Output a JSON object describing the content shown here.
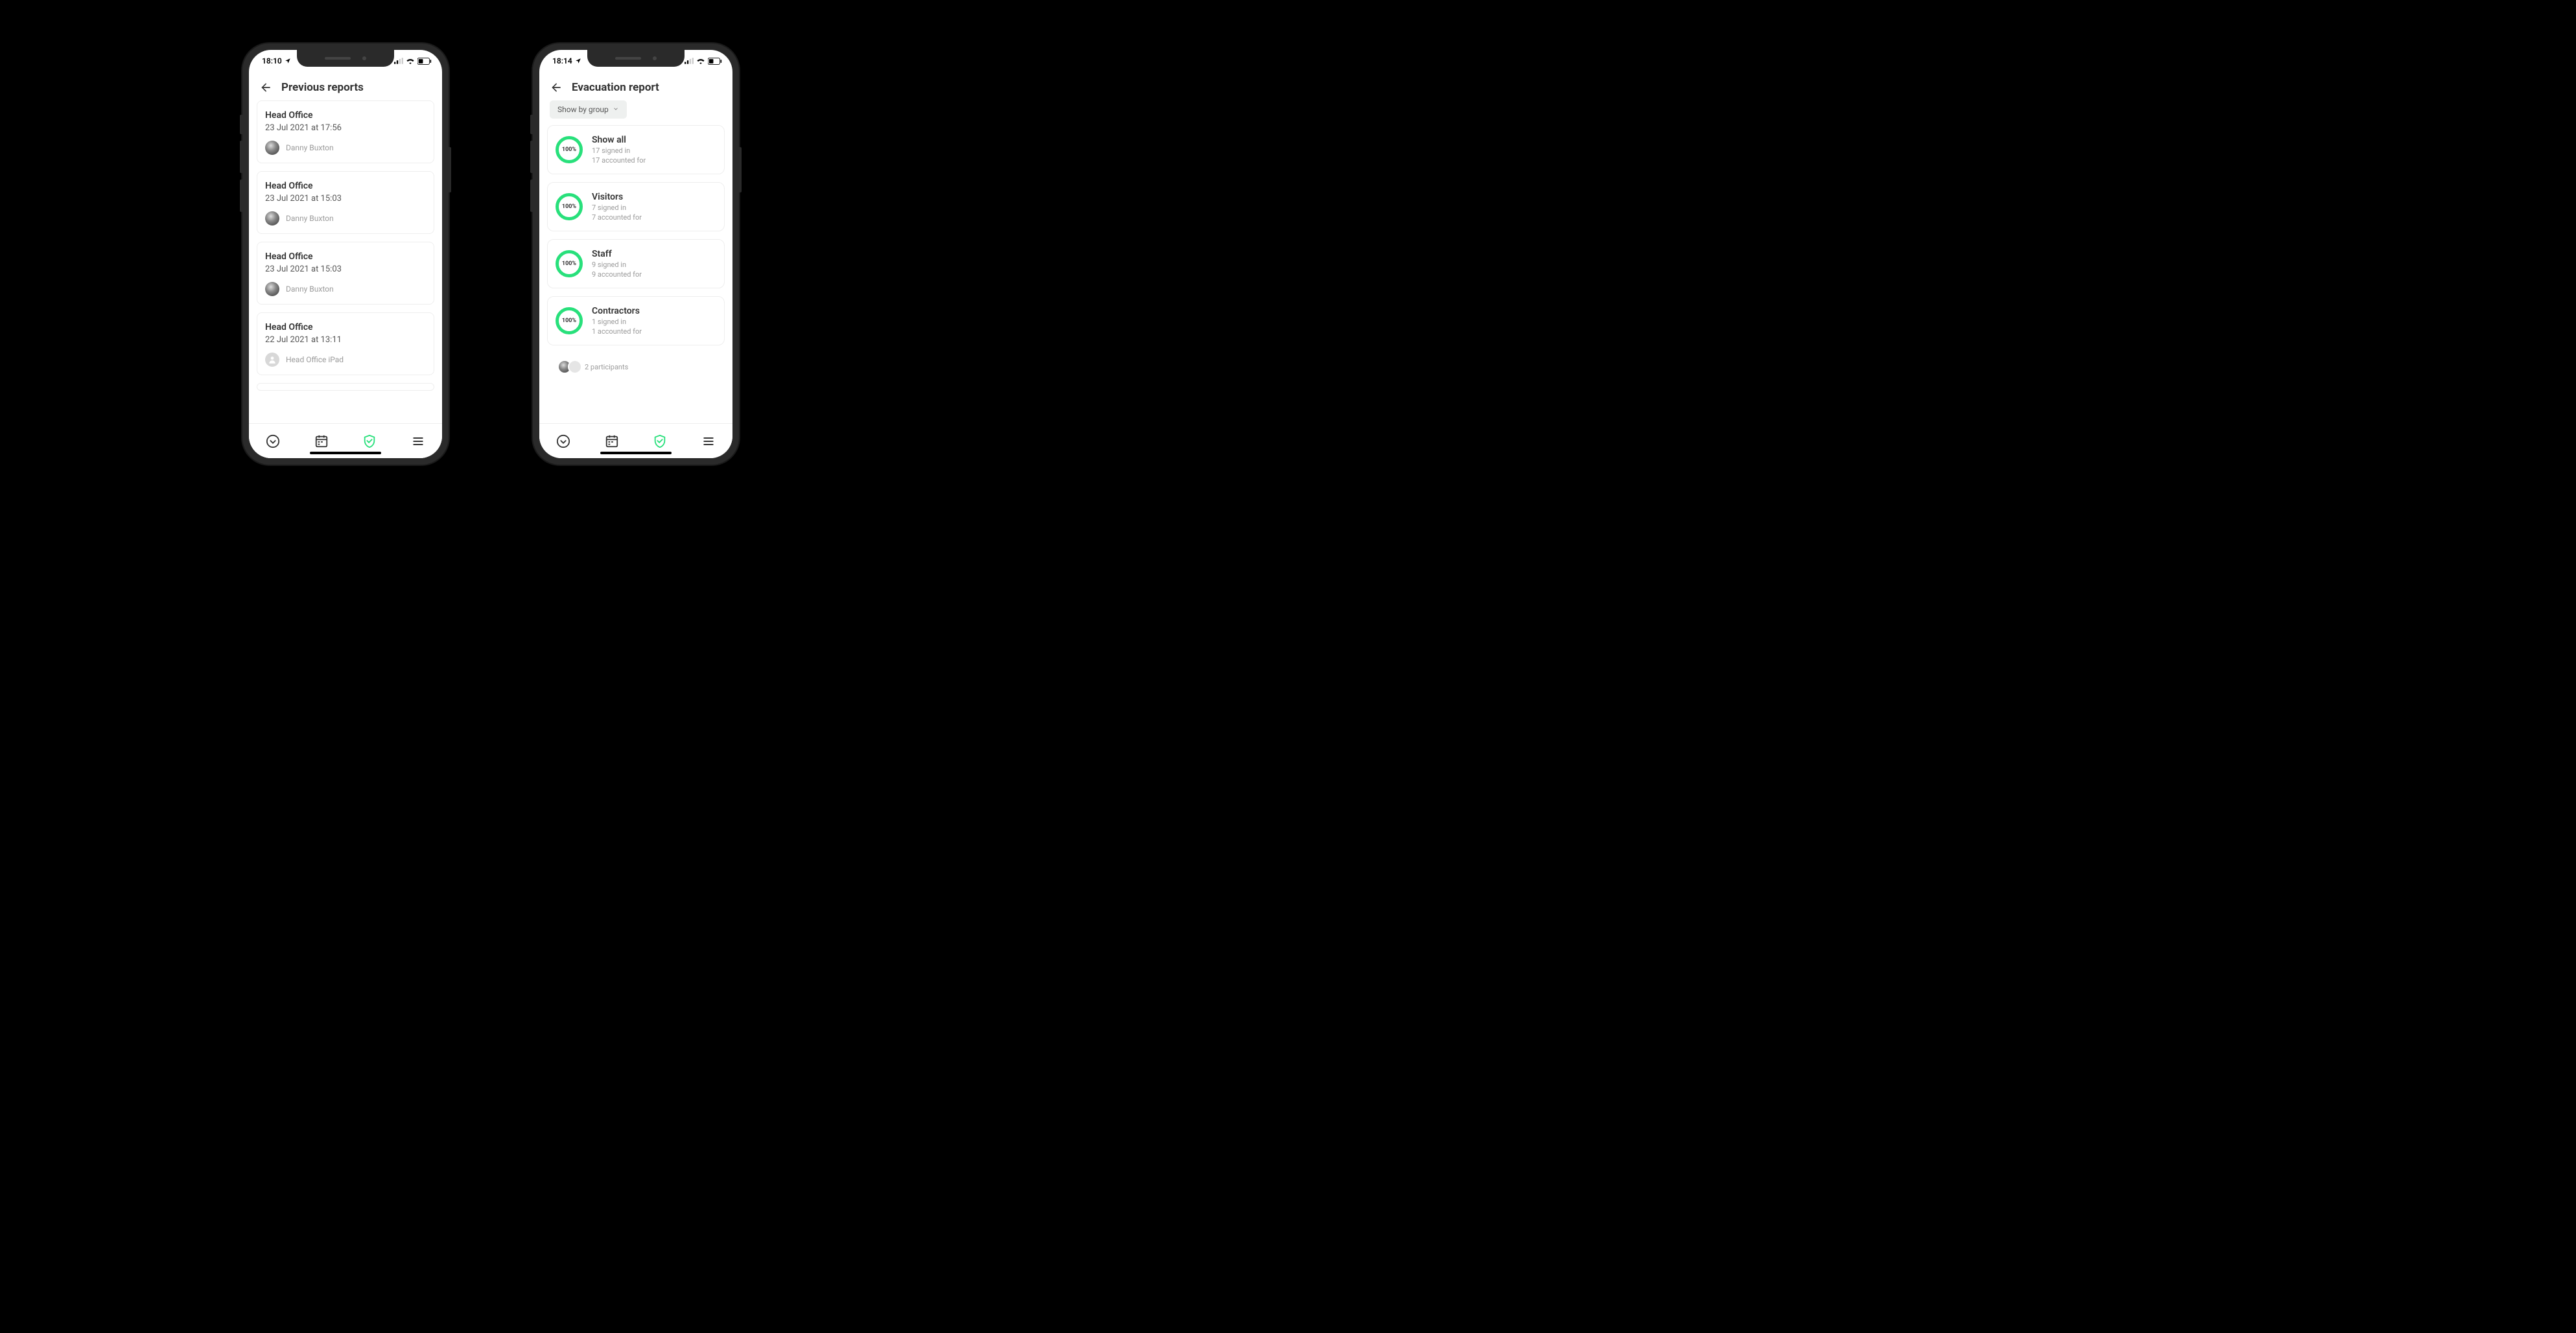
{
  "colors": {
    "accent": "#28e07b",
    "text": "#333333",
    "muted": "#9a9a9a",
    "border": "#eeeeee"
  },
  "phoneA": {
    "status": {
      "time": "18:10"
    },
    "header": {
      "title": "Previous reports"
    },
    "reports": [
      {
        "location": "Head Office",
        "datetime": "23 Jul 2021 at 17:56",
        "author": "Danny Buxton",
        "avatar": "photo"
      },
      {
        "location": "Head Office",
        "datetime": "23 Jul 2021 at 15:03",
        "author": "Danny Buxton",
        "avatar": "photo"
      },
      {
        "location": "Head Office",
        "datetime": "23 Jul 2021 at 15:03",
        "author": "Danny Buxton",
        "avatar": "photo"
      },
      {
        "location": "Head Office",
        "datetime": "22 Jul 2021 at 13:11",
        "author": "Head Office iPad",
        "avatar": "blank"
      }
    ]
  },
  "phoneB": {
    "status": {
      "time": "18:14"
    },
    "header": {
      "title": "Evacuation report"
    },
    "filter": {
      "label": "Show by group"
    },
    "groups": [
      {
        "percent": "100%",
        "title": "Show all",
        "signed_in": "17 signed in",
        "accounted": "17 accounted for"
      },
      {
        "percent": "100%",
        "title": "Visitors",
        "signed_in": "7 signed in",
        "accounted": "7 accounted for"
      },
      {
        "percent": "100%",
        "title": "Staff",
        "signed_in": "9 signed in",
        "accounted": "9 accounted for"
      },
      {
        "percent": "100%",
        "title": "Contractors",
        "signed_in": "1 signed in",
        "accounted": "1 accounted for"
      }
    ],
    "participants": {
      "label": "2 participants"
    }
  },
  "tabs": {
    "icons": [
      "clock-icon",
      "calendar-icon",
      "shield-icon",
      "menu-icon"
    ],
    "active_index": 2
  }
}
